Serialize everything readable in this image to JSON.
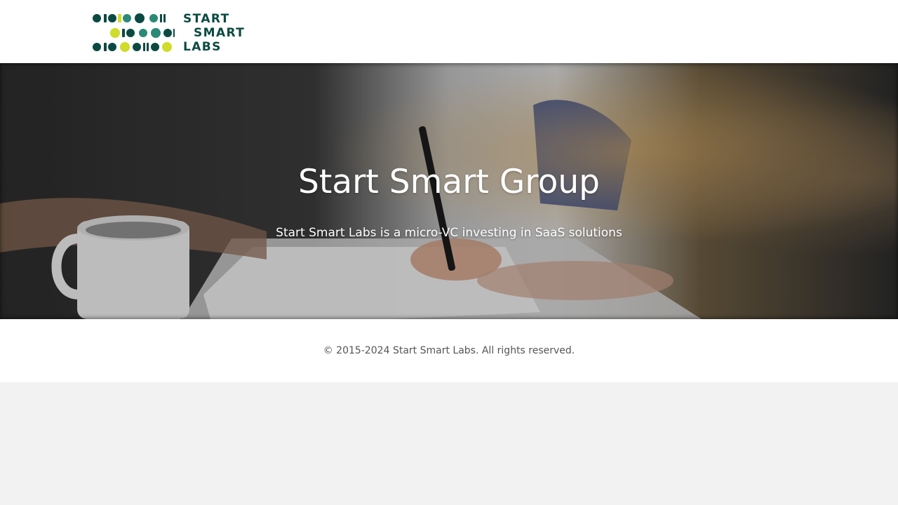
{
  "header": {
    "logo": {
      "line1": "START",
      "line2": "SMART",
      "line3": "LABS"
    }
  },
  "hero": {
    "title": "Start Smart Group",
    "subtitle": "Start Smart Labs is a micro-VC investing in SaaS solutions"
  },
  "footer": {
    "copyright": "© 2015-2024 Start Smart Labs. All rights reserved."
  },
  "colors": {
    "logo_dark": "#0b4a43",
    "logo_teal": "#2a8a77",
    "logo_lime": "#cfdc2a",
    "footer_text": "#555555",
    "page_bg": "#f2f2f2"
  }
}
